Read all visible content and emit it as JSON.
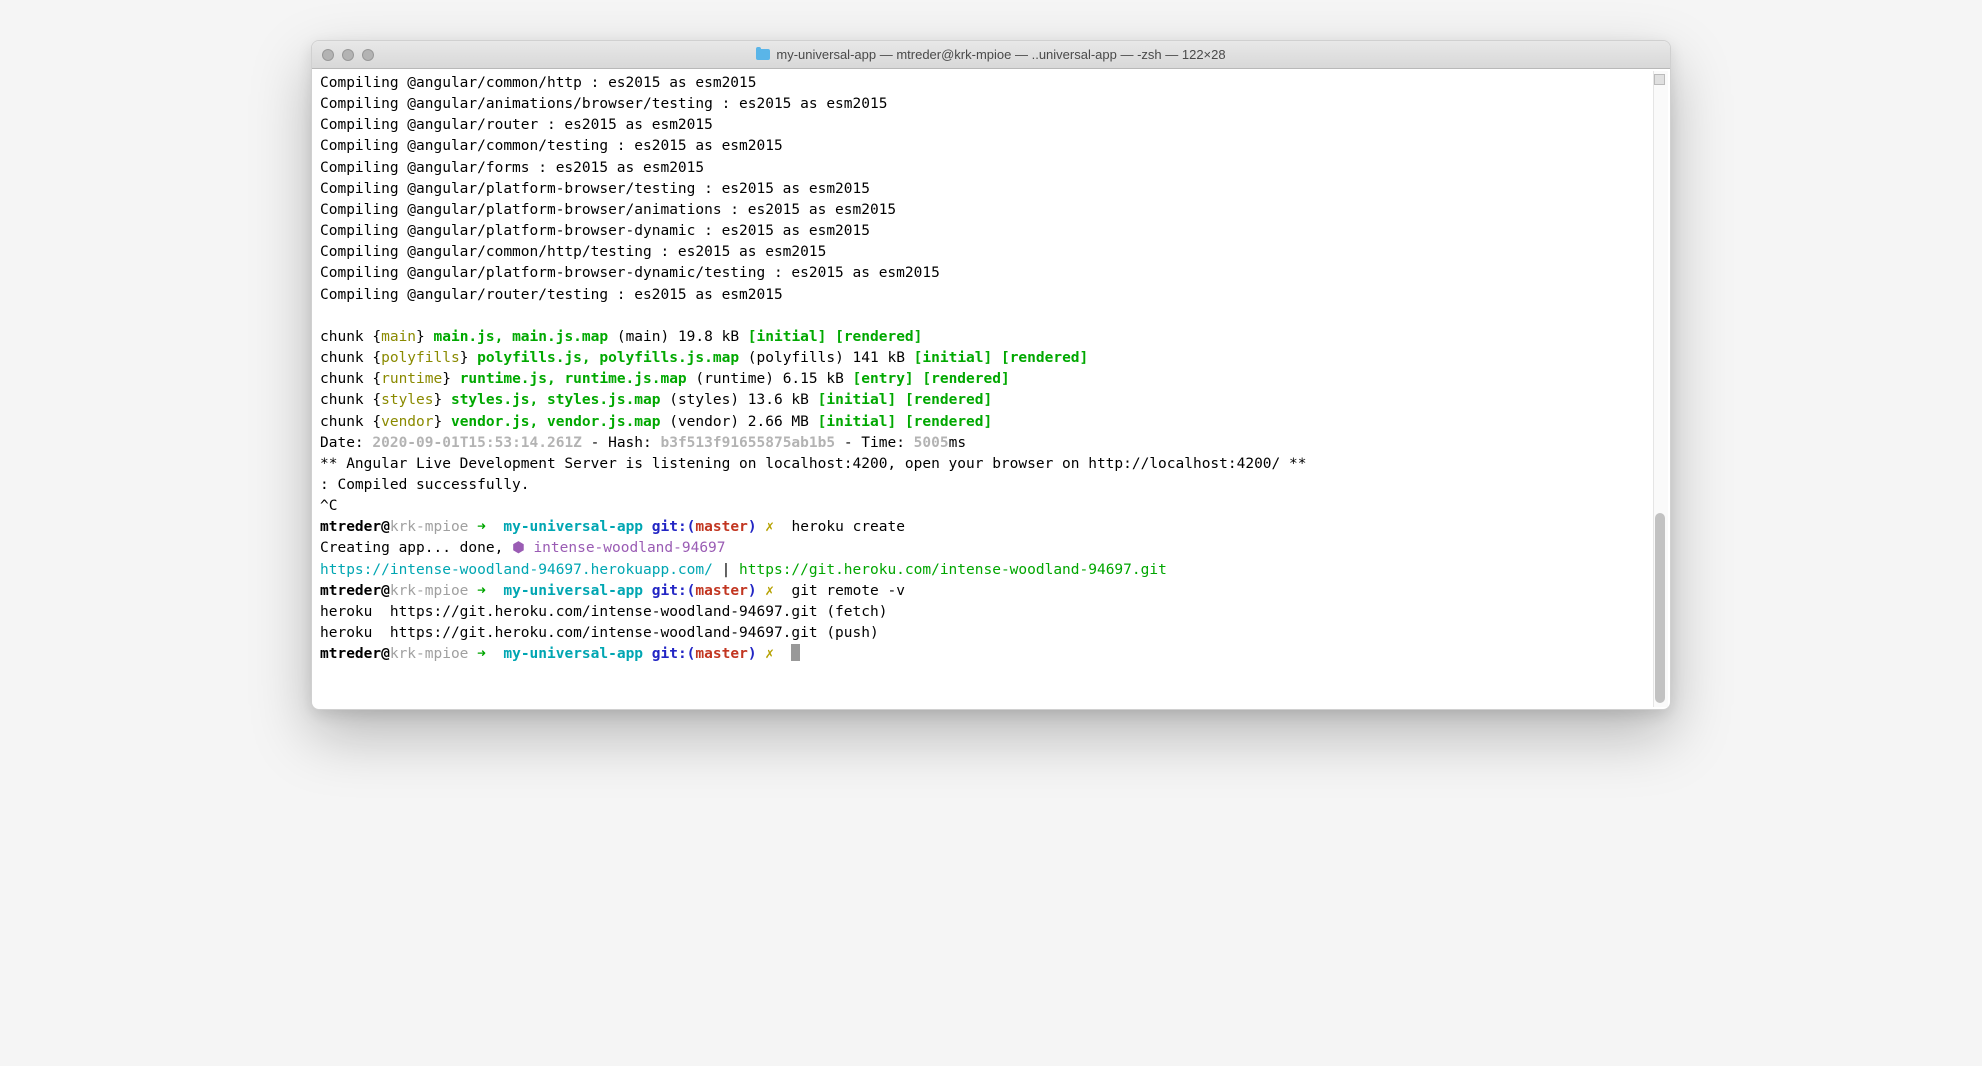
{
  "window": {
    "title": "my-universal-app — mtreder@krk-mpioe — ..universal-app — -zsh — 122×28"
  },
  "compiling": [
    "Compiling @angular/common/http : es2015 as esm2015",
    "Compiling @angular/animations/browser/testing : es2015 as esm2015",
    "Compiling @angular/router : es2015 as esm2015",
    "Compiling @angular/common/testing : es2015 as esm2015",
    "Compiling @angular/forms : es2015 as esm2015",
    "Compiling @angular/platform-browser/testing : es2015 as esm2015",
    "Compiling @angular/platform-browser/animations : es2015 as esm2015",
    "Compiling @angular/platform-browser-dynamic : es2015 as esm2015",
    "Compiling @angular/common/http/testing : es2015 as esm2015",
    "Compiling @angular/platform-browser-dynamic/testing : es2015 as esm2015",
    "Compiling @angular/router/testing : es2015 as esm2015"
  ],
  "chunks": [
    {
      "name": "main",
      "files": "main.js, main.js.map",
      "meta": "(main) 19.8 kB",
      "tags": "[initial] [rendered]"
    },
    {
      "name": "polyfills",
      "files": "polyfills.js, polyfills.js.map",
      "meta": "(polyfills) 141 kB",
      "tags": "[initial] [rendered]"
    },
    {
      "name": "runtime",
      "files": "runtime.js, runtime.js.map",
      "meta": "(runtime) 6.15 kB",
      "tags": "[entry] [rendered]"
    },
    {
      "name": "styles",
      "files": "styles.js, styles.js.map",
      "meta": "(styles) 13.6 kB",
      "tags": "[initial] [rendered]"
    },
    {
      "name": "vendor",
      "files": "vendor.js, vendor.js.map",
      "meta": "(vendor) 2.66 MB",
      "tags": "[initial] [rendered]"
    }
  ],
  "build": {
    "date_label": "Date: ",
    "date": "2020-09-01T15:53:14.261Z",
    "sep1": " - Hash: ",
    "hash": "b3f513f91655875ab1b5",
    "sep2": " - Time: ",
    "time": "5005",
    "ms": "ms"
  },
  "server_msg": "** Angular Live Development Server is listening on localhost:4200, open your browser on http://localhost:4200/ **",
  "compiled": ": Compiled successfully.",
  "interrupt": "^C",
  "prompt": {
    "user": "mtreder@",
    "host": "krk-mpioe ",
    "arrow": "➜  ",
    "dir": "my-universal-app ",
    "git_label": "git:(",
    "git_branch": "master",
    "git_close": ") ",
    "dirty": "✗",
    "space": "  "
  },
  "cmd1": "heroku create",
  "heroku": {
    "creating_prefix": "Creating app... done, ",
    "icon": "⬢ ",
    "app_name": "intense-woodland-94697",
    "url_web": "https://intense-woodland-94697.herokuapp.com/",
    "sep": " | ",
    "url_git": "https://git.heroku.com/intense-woodland-94697.git"
  },
  "cmd2": "git remote -v",
  "remotes": [
    "heroku  https://git.heroku.com/intense-woodland-94697.git (fetch)",
    "heroku  https://git.heroku.com/intense-woodland-94697.git (push)"
  ],
  "tokens": {
    "chunk_prefix": "chunk {",
    "chunk_suffix": "} "
  }
}
